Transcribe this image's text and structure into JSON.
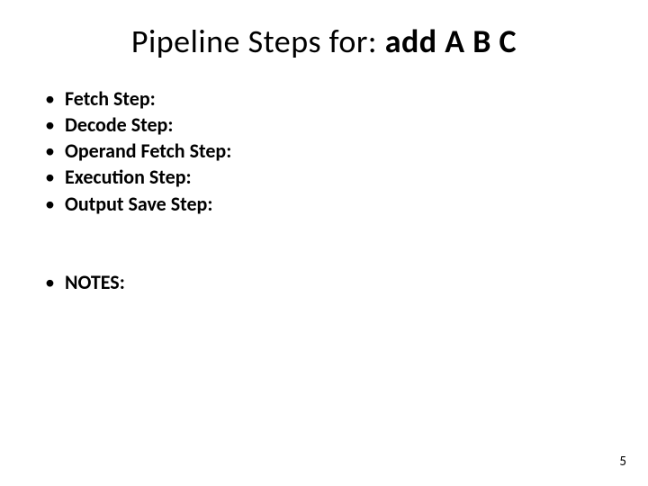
{
  "title_prefix": "Pipeline Steps for: ",
  "title_bold": "add A B C",
  "bullets_group1": [
    "Fetch Step:",
    "Decode Step:",
    "Operand Fetch Step:",
    "Execution Step:",
    "Output Save Step:"
  ],
  "bullets_group2": [
    "NOTES:"
  ],
  "page_number": "5"
}
